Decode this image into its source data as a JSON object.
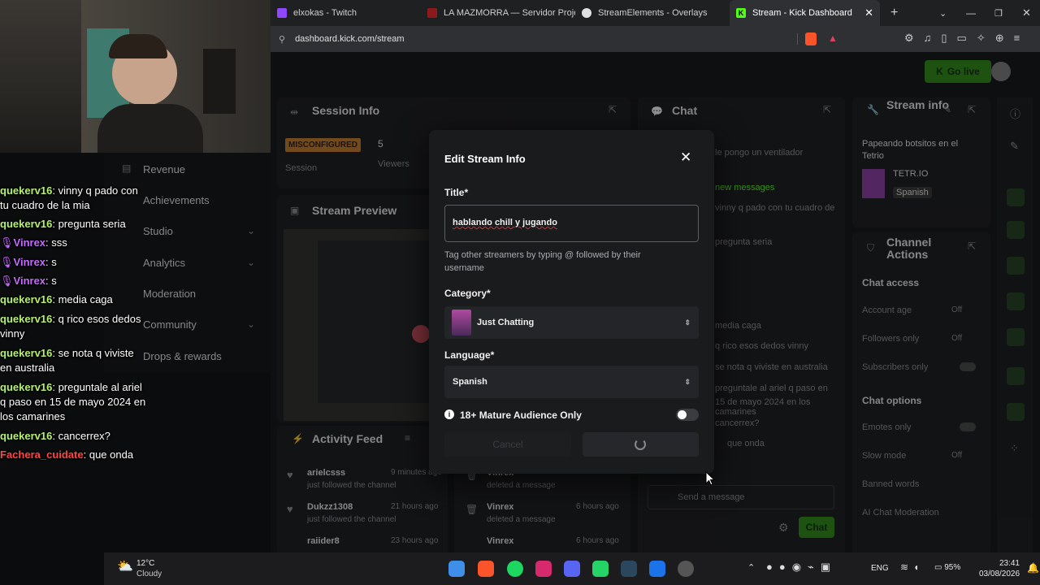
{
  "browser": {
    "tabs": [
      {
        "label": "elxokas - Twitch",
        "color": "#9146ff"
      },
      {
        "label": "LA MAZMORRA — Servidor Project",
        "color": "#8b1a1a"
      },
      {
        "label": "StreamElements - Overlays",
        "color": "#e0e0e0"
      },
      {
        "label": "Stream - Kick Dashboard",
        "color": "#53fc18"
      }
    ],
    "new_tab": "+",
    "url": "dashboard.kick.com/stream"
  },
  "dashboard": {
    "go_live": "Go live",
    "session_info": "Session Info",
    "status_badge": "MISCONFIGURED",
    "session_label": "Session",
    "viewers_count": "5",
    "viewers_label": "Viewers",
    "stream_preview": "Stream Preview",
    "activity_feed": "Activity Feed",
    "activity": [
      {
        "user": "arielcsss",
        "time": "9 minutes ago",
        "action": "just followed the channel"
      },
      {
        "user": "Dukzz1308",
        "time": "21 hours ago",
        "action": "just followed the channel"
      },
      {
        "user": "raiider8",
        "time": "23 hours ago",
        "action": ""
      }
    ],
    "mod_log": [
      {
        "user": "Vinrex",
        "time": "",
        "action": "deleted a message"
      },
      {
        "user": "Vinrex",
        "time": "6 hours ago",
        "action": "deleted a message"
      },
      {
        "user": "Vinrex",
        "time": "6 hours ago",
        "action": ""
      }
    ],
    "chat": "Chat",
    "chat_messages": [
      "le pongo un ventilador",
      "new messages",
      "vinny q pado con tu cuadro de",
      "pregunta seria",
      "media caga",
      "q rico esos dedos vinny",
      "se nota q viviste en australia",
      "preguntale al ariel q paso en",
      "15 de mayo 2024 en los camarines",
      "cancerrex?",
      "que onda"
    ],
    "send_placeholder": "Send a message",
    "chat_button": "Chat",
    "stream_info": "Stream info",
    "stream_title": "Papeando botsitos en el Tetrio",
    "game": "TETR.IO",
    "language": "Spanish",
    "channel_actions": "Channel Actions",
    "chat_access": "Chat access",
    "account_age": "Account age",
    "followers_only": "Followers only",
    "subscribers_only": "Subscribers only",
    "off": "Off",
    "chat_options": "Chat options",
    "emotes_only": "Emotes only",
    "slow_mode": "Slow mode",
    "banned_words": "Banned words",
    "ai_moderation": "AI Chat Moderation"
  },
  "sidebar": {
    "items": [
      "Revenue",
      "Achievements",
      "Studio",
      "Analytics",
      "Moderation",
      "Community",
      "Drops & rewards"
    ]
  },
  "overlay_chat": [
    {
      "user": "quekerv16",
      "color": "#b4f06c",
      "text": "vinny q pado con tu cuadro de la mia"
    },
    {
      "user": "quekerv16",
      "color": "#b4f06c",
      "text": "pregunta seria"
    },
    {
      "user": "Vinrex",
      "color": "#c56bff",
      "text": "sss"
    },
    {
      "user": "Vinrex",
      "color": "#c56bff",
      "text": "s"
    },
    {
      "user": "Vinrex",
      "color": "#c56bff",
      "text": "s"
    },
    {
      "user": "quekerv16",
      "color": "#b4f06c",
      "text": "media caga"
    },
    {
      "user": "quekerv16",
      "color": "#b4f06c",
      "text": "q rico esos dedos vinny"
    },
    {
      "user": "quekerv16",
      "color": "#b4f06c",
      "text": "se nota q viviste en australia"
    },
    {
      "user": "quekerv16",
      "color": "#b4f06c",
      "text": "preguntale al ariel q paso en 15 de mayo 2024 en los camarines"
    },
    {
      "user": "quekerv16",
      "color": "#b4f06c",
      "text": "cancerrex?"
    },
    {
      "user": "Fachera_cuidate",
      "color": "#ff4545",
      "text": "que onda"
    }
  ],
  "modal": {
    "title": "Edit Stream Info",
    "title_label": "Title*",
    "title_value": "hablando chill y jugando",
    "hint": "Tag other streamers by typing @ followed by their username",
    "category_label": "Category*",
    "category_value": "Just Chatting",
    "language_label": "Language*",
    "language_value": "Spanish",
    "mature_label": "18+ Mature Audience Only",
    "mature_enabled": false,
    "cancel": "Cancel"
  },
  "taskbar": {
    "temp": "12°C",
    "weather": "Cloudy",
    "lang": "ENG",
    "battery": "95%",
    "time": "23:41",
    "date": "03/08/2026"
  },
  "colors": {
    "kick_green": "#53fc18",
    "bg": "#0e0f10",
    "card": "#17181a"
  }
}
